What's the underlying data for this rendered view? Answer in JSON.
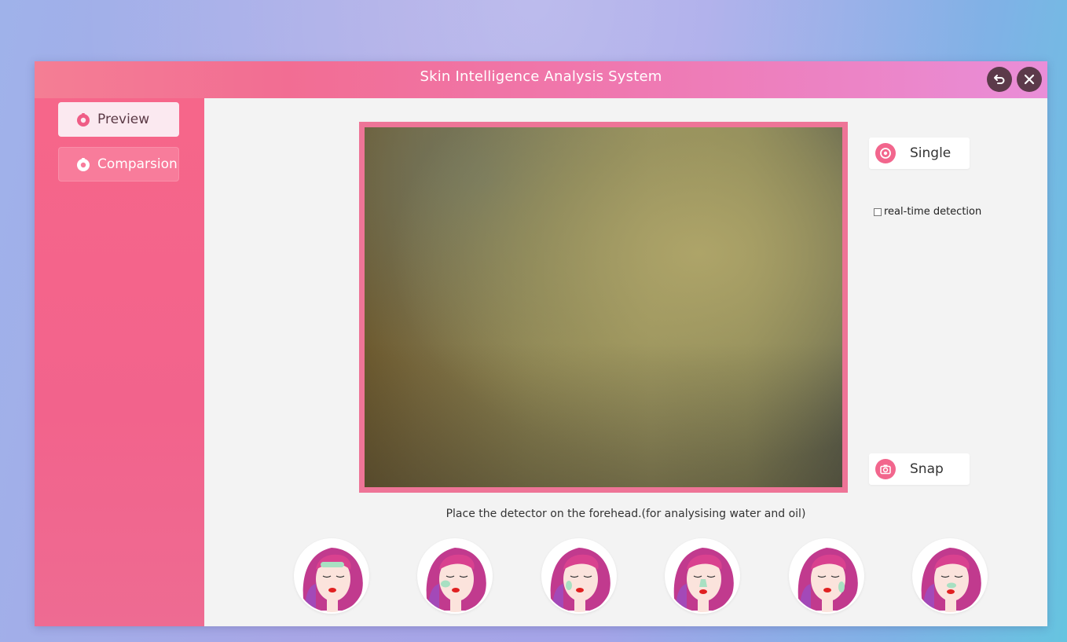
{
  "window": {
    "title": "Skin Intelligence Analysis System",
    "back_icon": "undo-icon",
    "close_icon": "close-icon"
  },
  "sidebar": {
    "items": [
      {
        "label": "Preview",
        "icon": "flower-icon",
        "active": true
      },
      {
        "label": "Comparsion",
        "icon": "flower-icon",
        "active": false
      }
    ]
  },
  "controls": {
    "single_label": "Single",
    "realtime_label": "real-time detection",
    "realtime_checked": false,
    "snap_label": "Snap"
  },
  "instruction": "Place the detector on the forehead.(for analysising water and oil)",
  "face_positions": [
    "forehead",
    "left-cheek",
    "right-cheek",
    "nose",
    "chin-side",
    "nose-tip"
  ],
  "colors": {
    "accent": "#f2668d",
    "highlight_zone": "#a8e0c2"
  }
}
